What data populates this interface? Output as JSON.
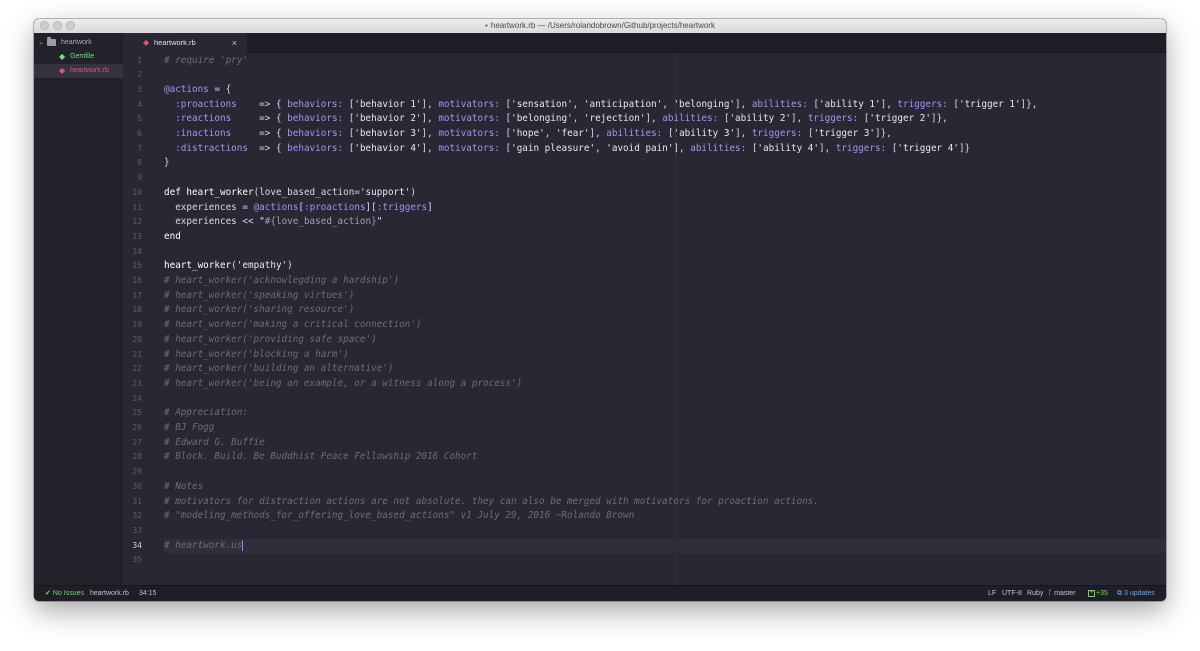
{
  "window": {
    "title": "heartwork.rb — /Users/rolandobrown/Github/projects/heartwork"
  },
  "sidebar": {
    "root": "heartwork",
    "items": [
      {
        "label": "Gemfile"
      },
      {
        "label": "heartwork.rb"
      }
    ]
  },
  "tabs": [
    {
      "label": "heartwork.rb",
      "close": "×"
    }
  ],
  "editor": {
    "current_line": 34,
    "line_numbers": [
      "1",
      "2",
      "3",
      "4",
      "5",
      "6",
      "7",
      "8",
      "9",
      "10",
      "11",
      "12",
      "13",
      "14",
      "15",
      "16",
      "17",
      "18",
      "19",
      "20",
      "21",
      "22",
      "23",
      "24",
      "25",
      "26",
      "27",
      "28",
      "29",
      "30",
      "31",
      "32",
      "33",
      "34",
      "35"
    ],
    "lines": [
      "# require 'pry'",
      "",
      "@actions = {",
      "  :proactions    => { behaviors: ['behavior 1'], motivators: ['sensation', 'anticipation', 'belonging'], abilities: ['ability 1'], triggers: ['trigger 1']},",
      "  :reactions     => { behaviors: ['behavior 2'], motivators: ['belonging', 'rejection'], abilities: ['ability 2'], triggers: ['trigger 2']},",
      "  :inactions     => { behaviors: ['behavior 3'], motivators: ['hope', 'fear'], abilities: ['ability 3'], triggers: ['trigger 3']},",
      "  :distractions  => { behaviors: ['behavior 4'], motivators: ['gain pleasure', 'avoid pain'], abilities: ['ability 4'], triggers: ['trigger 4']}",
      "}",
      "",
      "def heart_worker(love_based_action='support')",
      "  experiences = @actions[:proactions][:triggers]",
      "  experiences << \"#{love_based_action}\"",
      "end",
      "",
      "heart_worker('empathy')",
      "# heart_worker('acknowlegding a hardship')",
      "# heart_worker('speaking virtues')",
      "# heart_worker('sharing resource')",
      "# heart_worker('making a critical connection')",
      "# heart_worker('providing safe space')",
      "# heart_worker('blocking a harm')",
      "# heart_worker('building an alternative')",
      "# heart_worker('being an example, or a witness along a process')",
      "",
      "# Appreciation:",
      "# BJ Fogg",
      "# Edward G. Buffie",
      "# Block. Build. Be Buddhist Peace Fellowship 2016 Cohort",
      "",
      "# Notes",
      "# motivators for distraction actions are not absolute. they can also be merged with motivators for proaction actions.",
      "# \"modeling_methods_for_offering_love_based_actions\" v1 July 29, 2016 ~Rolando Brown",
      "",
      "# heartwork.us",
      ""
    ]
  },
  "status": {
    "issues": "No Issues",
    "file": "heartwork.rb",
    "cursor": "34:15",
    "line_ending": "LF",
    "encoding": "UTF-8",
    "grammar": "Ruby",
    "branch": "master",
    "diff": "+35",
    "updates": "3 updates"
  },
  "colors": {
    "editor_bg": "#282733",
    "keyword": "#ffffff",
    "symbol": "#a593f0",
    "comment": "#6d6c7c",
    "ok": "#73d46b",
    "tab_ruby": "#e0556a",
    "updates": "#5da9ee"
  },
  "icons": [
    "folder-icon",
    "ruby-gem-icon",
    "close-icon",
    "check-icon",
    "git-branch-icon",
    "diff-icon",
    "package-icon"
  ]
}
